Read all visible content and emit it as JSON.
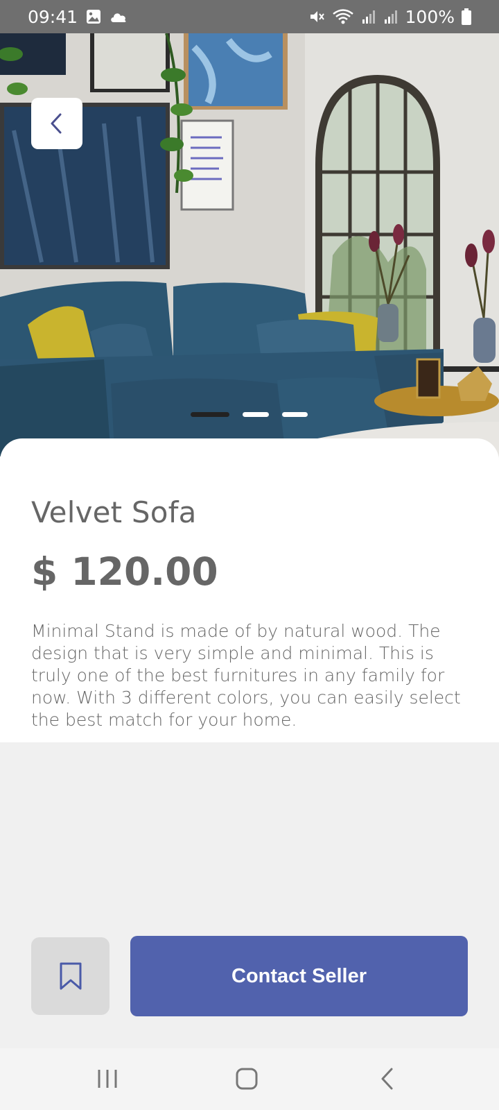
{
  "status_bar": {
    "time": "09:41",
    "battery": "100%",
    "icons": [
      "image-icon",
      "cloud-icon",
      "mute-icon",
      "wifi-icon",
      "signal-icon",
      "signal-icon",
      "battery-icon"
    ]
  },
  "hero": {
    "image": "living-room-blue-velvet-sofa-photo",
    "carousel": {
      "count": 3,
      "active_index": 0
    }
  },
  "product": {
    "title": "Velvet Sofa",
    "price": "$ 120.00",
    "description": "Minimal Stand is made of by natural wood. The design that is very simple and minimal. This is truly one of the best furnitures in any family for now. With 3 different colors, you can easily select the best match for your home."
  },
  "actions": {
    "bookmark_icon": "bookmark-icon",
    "contact_label": "Contact Seller"
  },
  "colors": {
    "accent": "#5162ad",
    "text": "#666666",
    "status_bar": "#6f6f6f",
    "background": "#f0f0f0"
  },
  "nav_bar": {
    "icons": [
      "recents-icon",
      "home-icon",
      "back-icon"
    ]
  }
}
